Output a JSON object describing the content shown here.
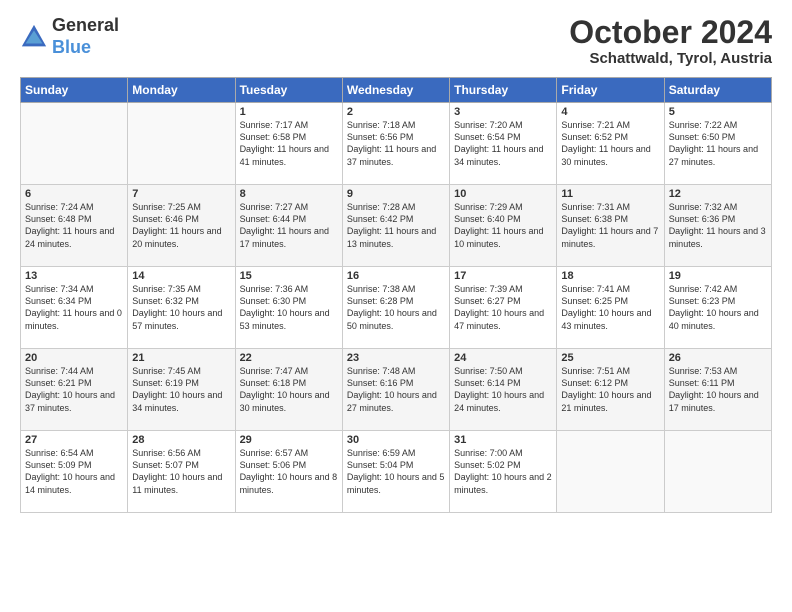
{
  "header": {
    "logo_line1": "General",
    "logo_line2": "Blue",
    "month": "October 2024",
    "location": "Schattwald, Tyrol, Austria"
  },
  "weekdays": [
    "Sunday",
    "Monday",
    "Tuesday",
    "Wednesday",
    "Thursday",
    "Friday",
    "Saturday"
  ],
  "rows": [
    [
      {
        "day": "",
        "info": ""
      },
      {
        "day": "",
        "info": ""
      },
      {
        "day": "1",
        "info": "Sunrise: 7:17 AM\nSunset: 6:58 PM\nDaylight: 11 hours and 41 minutes."
      },
      {
        "day": "2",
        "info": "Sunrise: 7:18 AM\nSunset: 6:56 PM\nDaylight: 11 hours and 37 minutes."
      },
      {
        "day": "3",
        "info": "Sunrise: 7:20 AM\nSunset: 6:54 PM\nDaylight: 11 hours and 34 minutes."
      },
      {
        "day": "4",
        "info": "Sunrise: 7:21 AM\nSunset: 6:52 PM\nDaylight: 11 hours and 30 minutes."
      },
      {
        "day": "5",
        "info": "Sunrise: 7:22 AM\nSunset: 6:50 PM\nDaylight: 11 hours and 27 minutes."
      }
    ],
    [
      {
        "day": "6",
        "info": "Sunrise: 7:24 AM\nSunset: 6:48 PM\nDaylight: 11 hours and 24 minutes."
      },
      {
        "day": "7",
        "info": "Sunrise: 7:25 AM\nSunset: 6:46 PM\nDaylight: 11 hours and 20 minutes."
      },
      {
        "day": "8",
        "info": "Sunrise: 7:27 AM\nSunset: 6:44 PM\nDaylight: 11 hours and 17 minutes."
      },
      {
        "day": "9",
        "info": "Sunrise: 7:28 AM\nSunset: 6:42 PM\nDaylight: 11 hours and 13 minutes."
      },
      {
        "day": "10",
        "info": "Sunrise: 7:29 AM\nSunset: 6:40 PM\nDaylight: 11 hours and 10 minutes."
      },
      {
        "day": "11",
        "info": "Sunrise: 7:31 AM\nSunset: 6:38 PM\nDaylight: 11 hours and 7 minutes."
      },
      {
        "day": "12",
        "info": "Sunrise: 7:32 AM\nSunset: 6:36 PM\nDaylight: 11 hours and 3 minutes."
      }
    ],
    [
      {
        "day": "13",
        "info": "Sunrise: 7:34 AM\nSunset: 6:34 PM\nDaylight: 11 hours and 0 minutes."
      },
      {
        "day": "14",
        "info": "Sunrise: 7:35 AM\nSunset: 6:32 PM\nDaylight: 10 hours and 57 minutes."
      },
      {
        "day": "15",
        "info": "Sunrise: 7:36 AM\nSunset: 6:30 PM\nDaylight: 10 hours and 53 minutes."
      },
      {
        "day": "16",
        "info": "Sunrise: 7:38 AM\nSunset: 6:28 PM\nDaylight: 10 hours and 50 minutes."
      },
      {
        "day": "17",
        "info": "Sunrise: 7:39 AM\nSunset: 6:27 PM\nDaylight: 10 hours and 47 minutes."
      },
      {
        "day": "18",
        "info": "Sunrise: 7:41 AM\nSunset: 6:25 PM\nDaylight: 10 hours and 43 minutes."
      },
      {
        "day": "19",
        "info": "Sunrise: 7:42 AM\nSunset: 6:23 PM\nDaylight: 10 hours and 40 minutes."
      }
    ],
    [
      {
        "day": "20",
        "info": "Sunrise: 7:44 AM\nSunset: 6:21 PM\nDaylight: 10 hours and 37 minutes."
      },
      {
        "day": "21",
        "info": "Sunrise: 7:45 AM\nSunset: 6:19 PM\nDaylight: 10 hours and 34 minutes."
      },
      {
        "day": "22",
        "info": "Sunrise: 7:47 AM\nSunset: 6:18 PM\nDaylight: 10 hours and 30 minutes."
      },
      {
        "day": "23",
        "info": "Sunrise: 7:48 AM\nSunset: 6:16 PM\nDaylight: 10 hours and 27 minutes."
      },
      {
        "day": "24",
        "info": "Sunrise: 7:50 AM\nSunset: 6:14 PM\nDaylight: 10 hours and 24 minutes."
      },
      {
        "day": "25",
        "info": "Sunrise: 7:51 AM\nSunset: 6:12 PM\nDaylight: 10 hours and 21 minutes."
      },
      {
        "day": "26",
        "info": "Sunrise: 7:53 AM\nSunset: 6:11 PM\nDaylight: 10 hours and 17 minutes."
      }
    ],
    [
      {
        "day": "27",
        "info": "Sunrise: 6:54 AM\nSunset: 5:09 PM\nDaylight: 10 hours and 14 minutes."
      },
      {
        "day": "28",
        "info": "Sunrise: 6:56 AM\nSunset: 5:07 PM\nDaylight: 10 hours and 11 minutes."
      },
      {
        "day": "29",
        "info": "Sunrise: 6:57 AM\nSunset: 5:06 PM\nDaylight: 10 hours and 8 minutes."
      },
      {
        "day": "30",
        "info": "Sunrise: 6:59 AM\nSunset: 5:04 PM\nDaylight: 10 hours and 5 minutes."
      },
      {
        "day": "31",
        "info": "Sunrise: 7:00 AM\nSunset: 5:02 PM\nDaylight: 10 hours and 2 minutes."
      },
      {
        "day": "",
        "info": ""
      },
      {
        "day": "",
        "info": ""
      }
    ]
  ]
}
